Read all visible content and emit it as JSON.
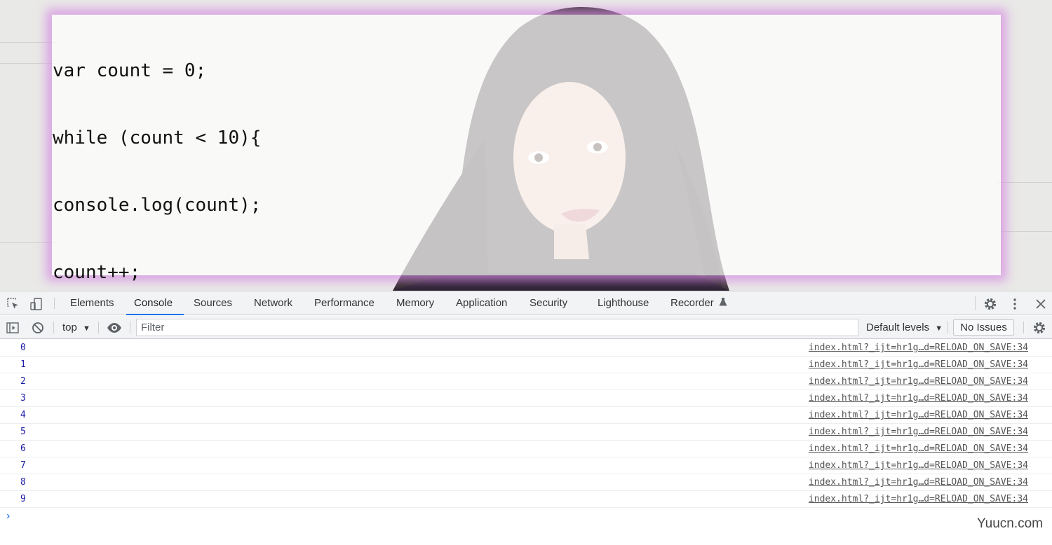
{
  "page": {
    "code_lines": [
      "var count = 0;",
      "while (count < 10){",
      "console.log(count);",
      "count++;",
      "}"
    ]
  },
  "devtools": {
    "tabs": [
      {
        "label": "Elements"
      },
      {
        "label": "Console"
      },
      {
        "label": "Sources"
      },
      {
        "label": "Network"
      },
      {
        "label": "Performance"
      },
      {
        "label": "Memory"
      },
      {
        "label": "Application"
      },
      {
        "label": "Security"
      },
      {
        "label": "Lighthouse"
      },
      {
        "label": "Recorder"
      }
    ],
    "active_tab": "Console",
    "icons": {
      "inspect": "inspect-element-icon",
      "device": "device-toolbar-icon",
      "recorder": "flask-icon",
      "settings": "gear-icon",
      "more": "kebab-menu-icon",
      "close": "close-icon"
    },
    "toolbar": {
      "context": "top",
      "filter_placeholder": "Filter",
      "levels": "Default levels",
      "issues": "No Issues"
    },
    "messages": [
      {
        "value": "0",
        "source": "index.html?_ijt=hr1g…d=RELOAD_ON_SAVE:34"
      },
      {
        "value": "1",
        "source": "index.html?_ijt=hr1g…d=RELOAD_ON_SAVE:34"
      },
      {
        "value": "2",
        "source": "index.html?_ijt=hr1g…d=RELOAD_ON_SAVE:34"
      },
      {
        "value": "3",
        "source": "index.html?_ijt=hr1g…d=RELOAD_ON_SAVE:34"
      },
      {
        "value": "4",
        "source": "index.html?_ijt=hr1g…d=RELOAD_ON_SAVE:34"
      },
      {
        "value": "5",
        "source": "index.html?_ijt=hr1g…d=RELOAD_ON_SAVE:34"
      },
      {
        "value": "6",
        "source": "index.html?_ijt=hr1g…d=RELOAD_ON_SAVE:34"
      },
      {
        "value": "7",
        "source": "index.html?_ijt=hr1g…d=RELOAD_ON_SAVE:34"
      },
      {
        "value": "8",
        "source": "index.html?_ijt=hr1g…d=RELOAD_ON_SAVE:34"
      },
      {
        "value": "9",
        "source": "index.html?_ijt=hr1g…d=RELOAD_ON_SAVE:34"
      }
    ],
    "prompt": "›"
  },
  "watermark": "Yuucn.com",
  "colors": {
    "accent": "#1a73e8",
    "glow": "#d68ce2",
    "log_value": "#1a1aa6"
  }
}
